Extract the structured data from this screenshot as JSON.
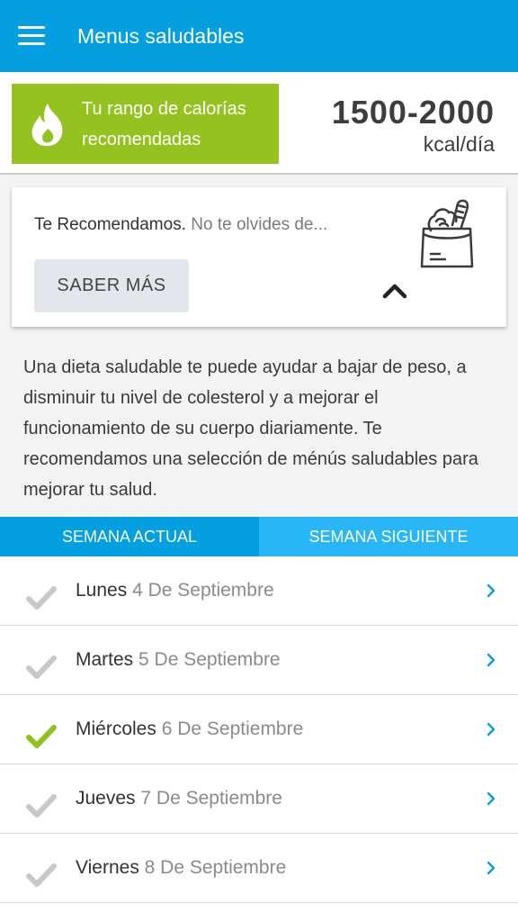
{
  "appbar": {
    "title": "Menus saludables",
    "menu_icon": "hamburger-menu-icon",
    "color": "#039fe0"
  },
  "calories": {
    "label_line1": "Tu rango de calorías",
    "label_line2": "recomendadas",
    "range": "1500-2000",
    "unit": "kcal/día",
    "icon": "flame-icon",
    "box_color": "#94c21f"
  },
  "recommendation": {
    "title": "Te Recomendamos.",
    "subtitle": "No te olvides de...",
    "button_label": "SABER MÁS",
    "icon": "grocery-bag-icon",
    "collapse_icon": "chevron-up-icon"
  },
  "description": "Una dieta saludable te puede ayudar a bajar de peso, a disminuir tu nivel de colesterol y a mejorar el funcionamiento de su cuerpo diariamente. Te recomendamos una selección de ménús saludables para mejorar tu salud.",
  "tabs": [
    {
      "label": "SEMANA ACTUAL",
      "active": true
    },
    {
      "label": "SEMANA SIGUIENTE",
      "active": false
    }
  ],
  "days": [
    {
      "day": "Lunes",
      "date": "4 De Septiembre",
      "checked": false
    },
    {
      "day": "Martes",
      "date": "5 De Septiembre",
      "checked": false
    },
    {
      "day": "Miércoles",
      "date": "6 De Septiembre",
      "checked": true
    },
    {
      "day": "Jueves",
      "date": "7 De Septiembre",
      "checked": false
    },
    {
      "day": "Viernes",
      "date": "8 De Septiembre",
      "checked": false
    }
  ],
  "colors": {
    "check_active": "#8dc21f",
    "check_inactive": "#c8c8c8",
    "chevron": "#039fe0"
  }
}
